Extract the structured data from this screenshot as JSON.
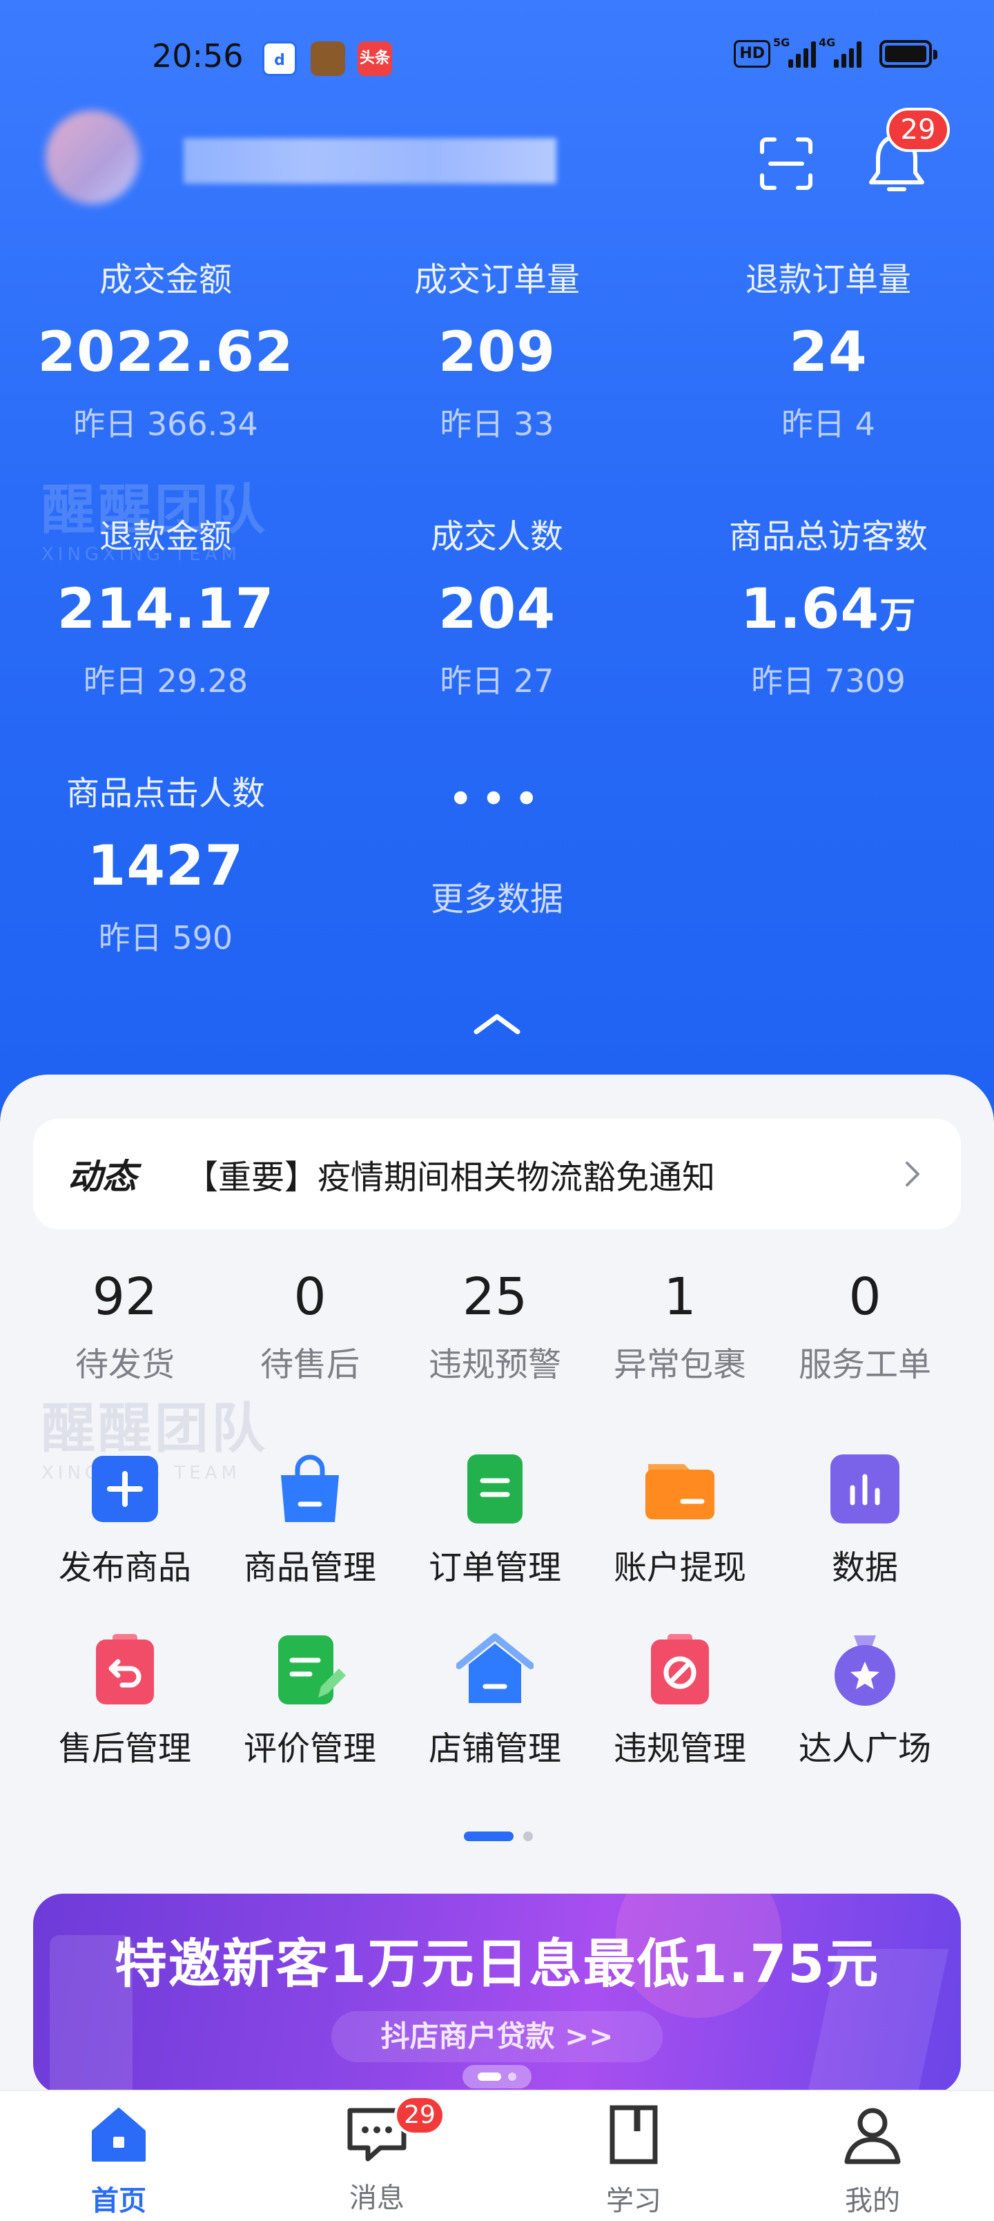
{
  "status_bar": {
    "time": "20:56",
    "apps": [
      "d",
      "game",
      "头条"
    ],
    "hd_label": "HD",
    "signal_1_tag": "5G",
    "signal_2_tag": "4G",
    "icons": [
      "hd-icon",
      "signal-5g-icon",
      "signal-4g-icon",
      "battery-icon"
    ]
  },
  "header": {
    "icons": [
      "scan-icon",
      "bell-icon"
    ],
    "notification_count": "29"
  },
  "stats": [
    {
      "label": "成交金额",
      "value": "2022.62",
      "unit": "",
      "prev": "昨日 366.34"
    },
    {
      "label": "成交订单量",
      "value": "209",
      "unit": "",
      "prev": "昨日 33"
    },
    {
      "label": "退款订单量",
      "value": "24",
      "unit": "",
      "prev": "昨日 4"
    },
    {
      "label": "退款金额",
      "value": "214.17",
      "unit": "",
      "prev": "昨日 29.28"
    },
    {
      "label": "成交人数",
      "value": "204",
      "unit": "",
      "prev": "昨日 27"
    },
    {
      "label": "商品总访客数",
      "value": "1.64",
      "unit": "万",
      "prev": "昨日 7309"
    },
    {
      "label": "商品点击人数",
      "value": "1427",
      "unit": "",
      "prev": "昨日 590"
    }
  ],
  "more_data": {
    "dots": "•••",
    "label": "更多数据"
  },
  "watermark": {
    "text": "醒醒团队",
    "sub": "XINGXING TEAM"
  },
  "news": {
    "tag": "动态",
    "text": "【重要】疫情期间相关物流豁免通知"
  },
  "counters": [
    {
      "num": "92",
      "label": "待发货"
    },
    {
      "num": "0",
      "label": "待售后"
    },
    {
      "num": "25",
      "label": "违规预警"
    },
    {
      "num": "1",
      "label": "异常包裹"
    },
    {
      "num": "0",
      "label": "服务工单"
    }
  ],
  "tools": [
    {
      "label": "发布商品",
      "icon": "plus-square-icon",
      "color": "#2a6cf7"
    },
    {
      "label": "商品管理",
      "icon": "shopping-bag-icon",
      "color": "#2f7bff"
    },
    {
      "label": "订单管理",
      "icon": "order-list-icon",
      "color": "#22b14c"
    },
    {
      "label": "账户提现",
      "icon": "wallet-icon",
      "color": "#ff8a1f"
    },
    {
      "label": "数据",
      "icon": "bar-chart-icon",
      "color": "#7a63e8"
    },
    {
      "label": "售后管理",
      "icon": "return-icon",
      "color": "#f24d68"
    },
    {
      "label": "评价管理",
      "icon": "review-icon",
      "color": "#26b64e"
    },
    {
      "label": "店铺管理",
      "icon": "store-icon",
      "color": "#2f7bff"
    },
    {
      "label": "违规管理",
      "icon": "forbidden-icon",
      "color": "#f24d68"
    },
    {
      "label": "达人广场",
      "icon": "star-medal-icon",
      "color": "#7a63e8"
    }
  ],
  "banner": {
    "title": "特邀新客1万元日息最低1.75元",
    "subtitle": "抖店商户贷款 >>"
  },
  "bottom_nav": [
    {
      "label": "首页",
      "icon": "home-icon",
      "active": true
    },
    {
      "label": "消息",
      "icon": "message-icon",
      "badge": "29"
    },
    {
      "label": "学习",
      "icon": "book-icon"
    },
    {
      "label": "我的",
      "icon": "profile-icon"
    }
  ],
  "colors": {
    "primary": "#2a6cf7",
    "badge": "#f23a3a"
  }
}
